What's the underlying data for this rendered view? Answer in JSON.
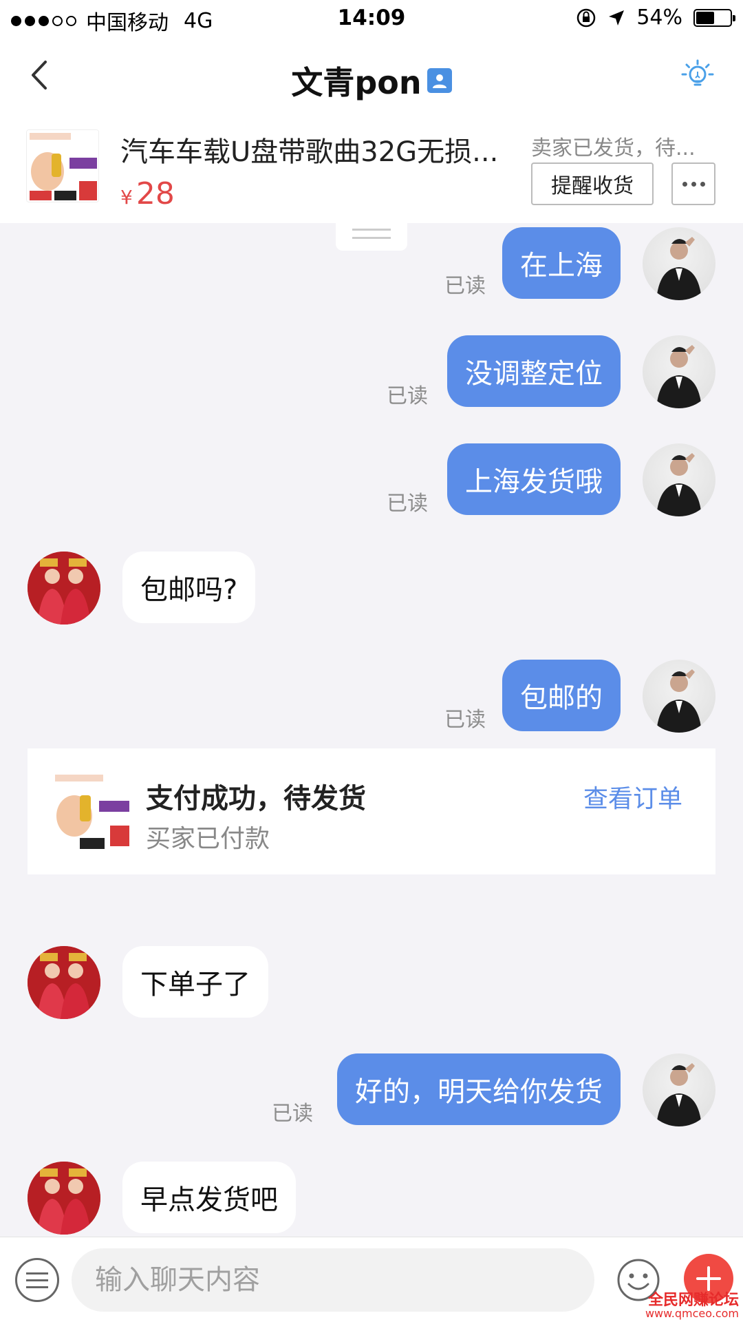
{
  "status_bar": {
    "carrier": "中国移动",
    "network": "4G",
    "time": "14:09",
    "battery": "54%",
    "battery_level": 0.54
  },
  "nav": {
    "title": "文青pon",
    "back_icon": "chevron-left-icon",
    "right_icon": "lightbulb-icon"
  },
  "product": {
    "title": "汽车车载U盘带歌曲32G无损...",
    "currency": "¥",
    "price": "28",
    "status": "卖家已发货，待...",
    "remind_button": "提醒收货"
  },
  "messages": [
    {
      "side": "out",
      "text": "在上海",
      "read": "已读"
    },
    {
      "side": "out",
      "text": "没调整定位",
      "read": "已读"
    },
    {
      "side": "out",
      "text": "上海发货哦",
      "read": "已读"
    },
    {
      "side": "in",
      "text": "包邮吗?"
    },
    {
      "side": "out",
      "text": "包邮的",
      "read": "已读"
    },
    {
      "side": "in",
      "text": "下单子了"
    },
    {
      "side": "out",
      "text": "好的，明天给你发货",
      "read": "已读"
    },
    {
      "side": "in",
      "text": "早点发货吧"
    }
  ],
  "order_card": {
    "title": "支付成功，待发货",
    "subtitle": "买家已付款",
    "link": "查看订单"
  },
  "input_bar": {
    "placeholder": "输入聊天内容"
  },
  "watermark": {
    "line1": "全民网赚论坛",
    "line2": "www.qmceo.com"
  },
  "colors": {
    "outgoing_bubble": "#5b8de8",
    "price": "#e24848",
    "link": "#5b8de8",
    "plus_button": "#f04a43"
  }
}
